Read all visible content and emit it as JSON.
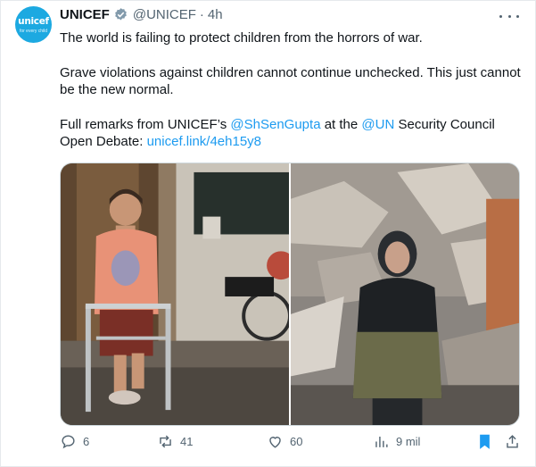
{
  "post": {
    "author_name": "UNICEF",
    "handle": "@UNICEF",
    "separator": "·",
    "time": "4h",
    "avatar_text": "unicef",
    "avatar_tagline": "for every child",
    "text": {
      "line1": "The world is failing to protect children from the horrors of war.",
      "line2": "Grave violations against children cannot continue unchecked. This just cannot be the new normal.",
      "line3_prefix": "Full remarks from UNICEF’s ",
      "mention1": "@ShSenGupta",
      "line3_mid": " at the ",
      "mention2": "@UN",
      "line3_suffix": " Security Council Open Debate: ",
      "link": "unicef.link/4eh15y8"
    }
  },
  "actions": {
    "replies": "6",
    "reposts": "41",
    "likes": "60",
    "views": "9 mil"
  },
  "icons": {
    "verified": "verified-badge-icon",
    "more": "more-icon",
    "reply": "reply-icon",
    "repost": "repost-icon",
    "like": "like-icon",
    "views": "views-icon",
    "bookmark": "bookmark-icon",
    "share": "share-icon"
  },
  "colors": {
    "accent": "#1d9bf0",
    "text": "#0f1419",
    "muted": "#536471",
    "unicef_blue": "#1ca9e1"
  }
}
